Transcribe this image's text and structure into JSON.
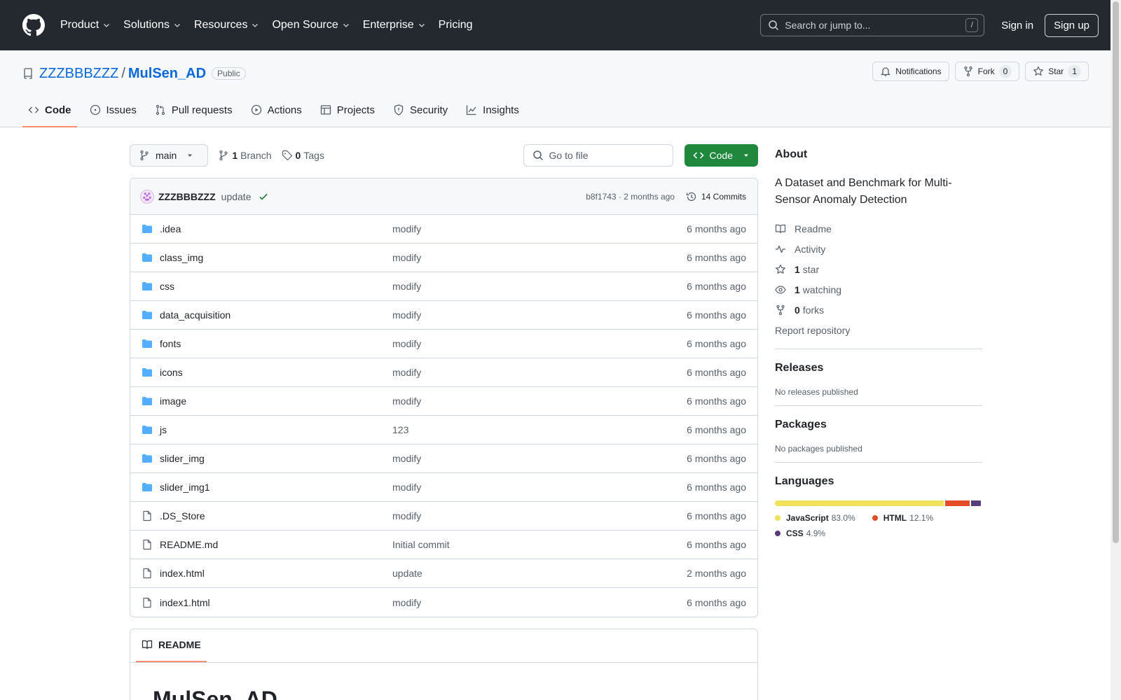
{
  "header": {
    "nav": [
      "Product",
      "Solutions",
      "Resources",
      "Open Source",
      "Enterprise",
      "Pricing"
    ],
    "search_placeholder": "Search or jump to...",
    "search_key": "/",
    "sign_in": "Sign in",
    "sign_up": "Sign up"
  },
  "repo": {
    "owner": "ZZZBBBZZZ",
    "sep": "/",
    "name": "MulSen_AD",
    "visibility": "Public",
    "notifications": "Notifications",
    "fork_label": "Fork",
    "fork_count": "0",
    "star_label": "Star",
    "star_count": "1",
    "tabs": [
      "Code",
      "Issues",
      "Pull requests",
      "Actions",
      "Projects",
      "Security",
      "Insights"
    ]
  },
  "toolbar": {
    "branch": "main",
    "branch_count": "1",
    "branch_label": "Branch",
    "tag_count": "0",
    "tag_label": "Tags",
    "goto_placeholder": "Go to file",
    "code_label": "Code"
  },
  "commit": {
    "author": "ZZZBBBZZZ",
    "message": "update",
    "hash_time": "b8f1743 · 2 months ago",
    "count": "14 Commits"
  },
  "files": [
    {
      "name": ".idea",
      "type": "dir",
      "commit": "modify",
      "age": "6 months ago"
    },
    {
      "name": "class_img",
      "type": "dir",
      "commit": "modify",
      "age": "6 months ago"
    },
    {
      "name": "css",
      "type": "dir",
      "commit": "modify",
      "age": "6 months ago"
    },
    {
      "name": "data_acquisition",
      "type": "dir",
      "commit": "modify",
      "age": "6 months ago"
    },
    {
      "name": "fonts",
      "type": "dir",
      "commit": "modify",
      "age": "6 months ago"
    },
    {
      "name": "icons",
      "type": "dir",
      "commit": "modify",
      "age": "6 months ago"
    },
    {
      "name": "image",
      "type": "dir",
      "commit": "modify",
      "age": "6 months ago"
    },
    {
      "name": "js",
      "type": "dir",
      "commit": "123",
      "age": "6 months ago"
    },
    {
      "name": "slider_img",
      "type": "dir",
      "commit": "modify",
      "age": "6 months ago"
    },
    {
      "name": "slider_img1",
      "type": "dir",
      "commit": "modify",
      "age": "6 months ago"
    },
    {
      "name": ".DS_Store",
      "type": "file",
      "commit": "modify",
      "age": "6 months ago"
    },
    {
      "name": "README.md",
      "type": "file",
      "commit": "Initial commit",
      "age": "6 months ago"
    },
    {
      "name": "index.html",
      "type": "file",
      "commit": "update",
      "age": "2 months ago"
    },
    {
      "name": "index1.html",
      "type": "file",
      "commit": "modify",
      "age": "6 months ago"
    }
  ],
  "readme": {
    "tab": "README",
    "heading": "MulSen_AD"
  },
  "about": {
    "title": "About",
    "description": "A Dataset and Benchmark for Multi-Sensor Anomaly Detection",
    "readme": "Readme",
    "activity": "Activity",
    "stars_count": "1",
    "stars_label": "star",
    "watching_count": "1",
    "watching_label": "watching",
    "forks_count": "0",
    "forks_label": "forks",
    "report": "Report repository"
  },
  "releases": {
    "title": "Releases",
    "empty": "No releases published"
  },
  "packages": {
    "title": "Packages",
    "empty": "No packages published"
  },
  "languages": {
    "title": "Languages",
    "items": [
      {
        "name": "JavaScript",
        "pct": "83.0%",
        "value": 83.0,
        "color": "#f1e05a"
      },
      {
        "name": "HTML",
        "pct": "12.1%",
        "value": 12.1,
        "color": "#e34c26"
      },
      {
        "name": "CSS",
        "pct": "4.9%",
        "value": 4.9,
        "color": "#563d7c"
      }
    ]
  }
}
